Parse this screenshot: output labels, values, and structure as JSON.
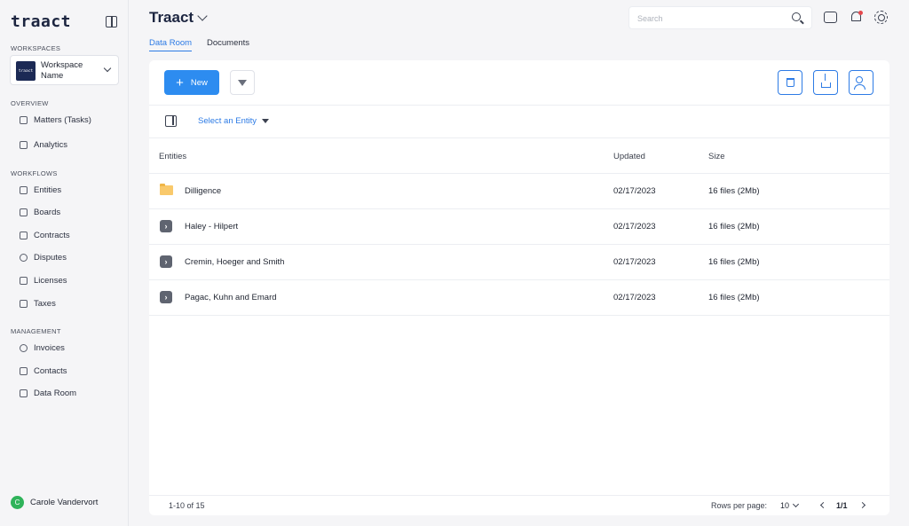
{
  "sidebar": {
    "logo": "traact",
    "workspaces_label": "WORKSPACES",
    "workspace": {
      "logo_text": "traact",
      "name": "Workspace Name"
    },
    "overview_label": "OVERVIEW",
    "overview_items": [
      "Matters (Tasks)",
      "Analytics"
    ],
    "workflows_label": "WORKFLOWS",
    "workflow_items": [
      "Entities",
      "Boards",
      "Contracts",
      "Disputes",
      "Licenses",
      "Taxes"
    ],
    "management_label": "MANAGEMENT",
    "management_items": [
      "Invoices",
      "Contacts",
      "Data Room"
    ],
    "user": {
      "initial": "C",
      "name": "Carole Vandervort"
    }
  },
  "header": {
    "title": "Traact",
    "search_placeholder": "Search",
    "tabs": [
      "Data Room",
      "Documents"
    ],
    "active_tab": "Data Room"
  },
  "toolbar": {
    "new_label": "New",
    "entity_select": "Select an Entity"
  },
  "table": {
    "columns": [
      "Entities",
      "Updated",
      "Size"
    ],
    "rows": [
      {
        "name": "Dilligence",
        "updated": "02/17/2023",
        "size": "16 files (2Mb)",
        "type": "folder"
      },
      {
        "name": "Haley - Hilpert",
        "updated": "02/17/2023",
        "size": "16 files (2Mb)",
        "type": "entity"
      },
      {
        "name": "Cremin, Hoeger and Smith",
        "updated": "02/17/2023",
        "size": "16 files (2Mb)",
        "type": "entity"
      },
      {
        "name": "Pagac, Kuhn and Emard",
        "updated": "02/17/2023",
        "size": "16 files (2Mb)",
        "type": "entity"
      }
    ]
  },
  "pagination": {
    "range": "1-10 of 15",
    "rows_per_page_label": "Rows per page:",
    "rows_per_page": "10",
    "page": "1/1"
  },
  "colors": {
    "accent": "#2d8cf0",
    "brand": "#1c2540",
    "folder": "#f9c96b",
    "notification": "#e5484d",
    "avatar": "#2fb35a"
  }
}
